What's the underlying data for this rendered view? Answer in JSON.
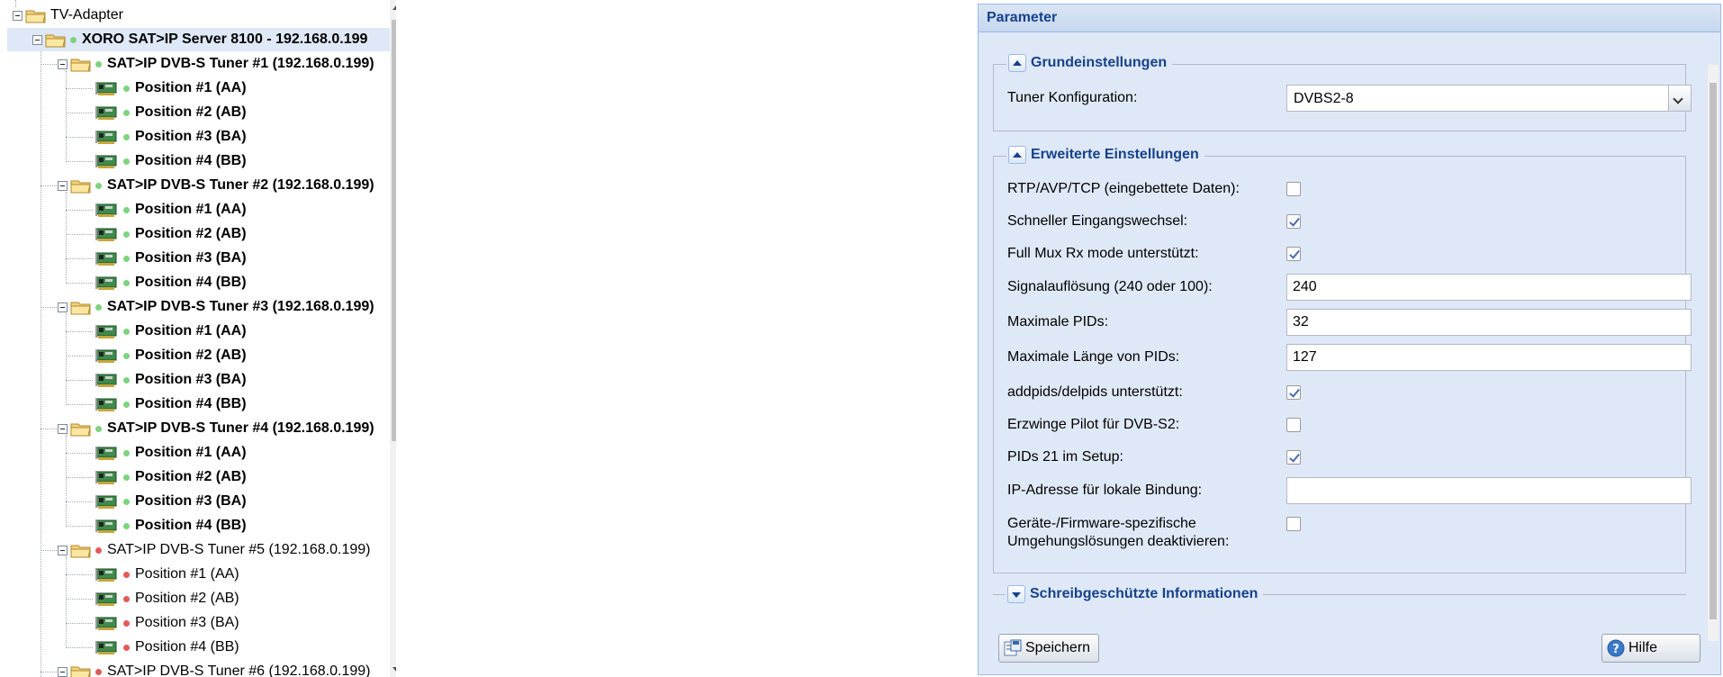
{
  "tree": {
    "root_label": "TV-Adapter",
    "server_label": "XORO SAT>IP Server 8100 - 192.168.0.199",
    "tuners": [
      {
        "label": "SAT>IP DVB-S Tuner #1 (192.168.0.199)",
        "status": "green",
        "positions": [
          "Position #1 (AA)",
          "Position #2 (AB)",
          "Position #3 (BA)",
          "Position #4 (BB)"
        ]
      },
      {
        "label": "SAT>IP DVB-S Tuner #2 (192.168.0.199)",
        "status": "green",
        "positions": [
          "Position #1 (AA)",
          "Position #2 (AB)",
          "Position #3 (BA)",
          "Position #4 (BB)"
        ]
      },
      {
        "label": "SAT>IP DVB-S Tuner #3 (192.168.0.199)",
        "status": "green",
        "positions": [
          "Position #1 (AA)",
          "Position #2 (AB)",
          "Position #3 (BA)",
          "Position #4 (BB)"
        ]
      },
      {
        "label": "SAT>IP DVB-S Tuner #4 (192.168.0.199)",
        "status": "green",
        "positions": [
          "Position #1 (AA)",
          "Position #2 (AB)",
          "Position #3 (BA)",
          "Position #4 (BB)"
        ]
      },
      {
        "label": "SAT>IP DVB-S Tuner #5 (192.168.0.199)",
        "status": "red",
        "positions": [
          "Position #1 (AA)",
          "Position #2 (AB)",
          "Position #3 (BA)",
          "Position #4 (BB)"
        ]
      },
      {
        "label": "SAT>IP DVB-S Tuner #6 (192.168.0.199)",
        "status": "red",
        "positions": []
      }
    ]
  },
  "panel": {
    "title": "Parameter",
    "basic": {
      "legend": "Grundeinstellungen",
      "tuner_config_label": "Tuner Konfiguration:",
      "tuner_config_value": "DVBS2-8"
    },
    "advanced": {
      "legend": "Erweiterte Einstellungen",
      "rtp_label": "RTP/AVP/TCP (eingebettete Daten):",
      "rtp_checked": false,
      "fast_switch_label": "Schneller Eingangswechsel:",
      "fast_switch_checked": true,
      "full_mux_label": "Full Mux Rx mode unterstützt:",
      "full_mux_checked": true,
      "signal_label": "Signalauflösung (240 oder 100):",
      "signal_value": "240",
      "max_pids_label": "Maximale PIDs:",
      "max_pids_value": "32",
      "max_pid_len_label": "Maximale Länge von PIDs:",
      "max_pid_len_value": "127",
      "addpids_label": "addpids/delpids unterstützt:",
      "addpids_checked": true,
      "pilot_label": "Erzwinge Pilot für DVB-S2:",
      "pilot_checked": false,
      "pids21_label": "PIDs 21 im Setup:",
      "pids21_checked": true,
      "ip_bind_label": "IP-Adresse für lokale Bindung:",
      "ip_bind_value": "",
      "workaround_label_1": "Geräte-/Firmware-spezifische",
      "workaround_label_2": "Umgehungslösungen deaktivieren:",
      "workaround_checked": false
    },
    "readonly": {
      "legend": "Schreibgeschützte Informationen"
    },
    "save_label": "Speichern",
    "help_label": "Hilfe"
  },
  "colors": {
    "panel_bg": "#dfe8f6",
    "header_text": "#15428b",
    "status_ok": "#7ed37e",
    "status_off": "#e35a5a"
  },
  "icons": [
    "folder-icon",
    "tuner-card-icon",
    "save-icon",
    "help-icon",
    "collapse-icon",
    "expand-icon",
    "dropdown-arrow-icon"
  ]
}
